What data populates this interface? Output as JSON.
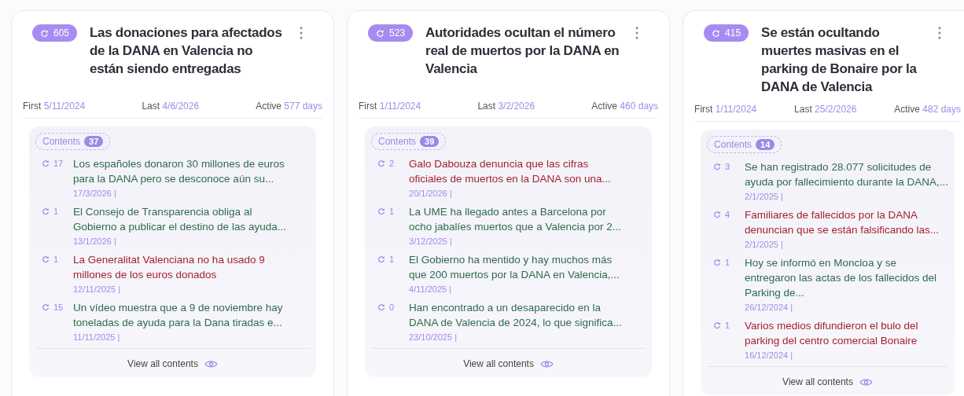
{
  "cards": [
    {
      "count": "605",
      "title": "Las donaciones para afectados de la DANA en Valencia no están siendo entregadas",
      "first_label": "First",
      "first": "5/11/2024",
      "last_label": "Last",
      "last": "4/6/2026",
      "active_label": "Active",
      "active": "577 days",
      "contents_label": "Contents",
      "contents_count": "37",
      "footer": "View all contents",
      "items": [
        {
          "count": "17",
          "title": "Los españoles donaron 30 millones de euros para la DANA pero se desconoce aún su...",
          "date": "17/3/2026 |",
          "color": "#2f6b4c"
        },
        {
          "count": "1",
          "title": "El Consejo de Transparencia obliga al Gobierno a publicar el destino de las ayuda...",
          "date": "13/1/2026 |",
          "color": "#2f6b4c"
        },
        {
          "count": "1",
          "title": "La Generalitat Valenciana no ha usado 9 millones de los euros donados",
          "date": "12/11/2025 |",
          "color": "#a3232f"
        },
        {
          "count": "15",
          "title": "Un vídeo muestra que a 9 de noviembre hay toneladas de ayuda para la Dana tiradas e...",
          "date": "11/11/2025 |",
          "color": "#2f6b4c"
        }
      ]
    },
    {
      "count": "523",
      "title": "Autoridades ocultan el número real de muertos por la DANA en Valencia",
      "first_label": "First",
      "first": "1/11/2024",
      "last_label": "Last",
      "last": "3/2/2026",
      "active_label": "Active",
      "active": "460 days",
      "contents_label": "Contents",
      "contents_count": "39",
      "footer": "View all contents",
      "items": [
        {
          "count": "2",
          "title": "Galo Dabouza denuncia que las cifras oficiales de muertos en la DANA son una...",
          "date": "20/1/2026 |",
          "color": "#a3232f"
        },
        {
          "count": "1",
          "title": "La UME ha llegado antes a Barcelona por ocho jabalíes muertos que a Valencia por 2...",
          "date": "3/12/2025 |",
          "color": "#2f6b4c"
        },
        {
          "count": "1",
          "title": "El Gobierno ha mentido y hay muchos más que 200 muertos por la DANA en Valencia,...",
          "date": "4/11/2025 |",
          "color": "#2f6b4c"
        },
        {
          "count": "0",
          "title": "Han encontrado a un desaparecido en la DANA de Valencia de 2024, lo que significa...",
          "date": "23/10/2025 |",
          "color": "#2f6b4c"
        }
      ]
    },
    {
      "count": "415",
      "title": "Se están ocultando muertes masivas en el parking de Bonaire por la DANA de Valencia",
      "first_label": "First",
      "first": "1/11/2024",
      "last_label": "Last",
      "last": "25/2/2026",
      "active_label": "Active",
      "active": "482 days",
      "contents_label": "Contents",
      "contents_count": "14",
      "footer": "View all contents",
      "items": [
        {
          "count": "3",
          "title": "Se han registrado 28.077 solicitudes de ayuda por fallecimiento durante la DANA,...",
          "date": "2/1/2025 |",
          "color": "#2f6b4c"
        },
        {
          "count": "4",
          "title": "Familiares de fallecidos por la DANA denuncian que se están falsificando las...",
          "date": "2/1/2025 |",
          "color": "#a3232f"
        },
        {
          "count": "1",
          "title": "Hoy se informó en Moncloa y se entregaron las actas de los fallecidos del Parking de...",
          "date": "26/12/2024 |",
          "color": "#2f6b4c"
        },
        {
          "count": "1",
          "title": "Varios medios difundieron el bulo del parking del centro comercial Bonaire",
          "date": "16/12/2024 |",
          "color": "#a3232f"
        }
      ]
    }
  ]
}
